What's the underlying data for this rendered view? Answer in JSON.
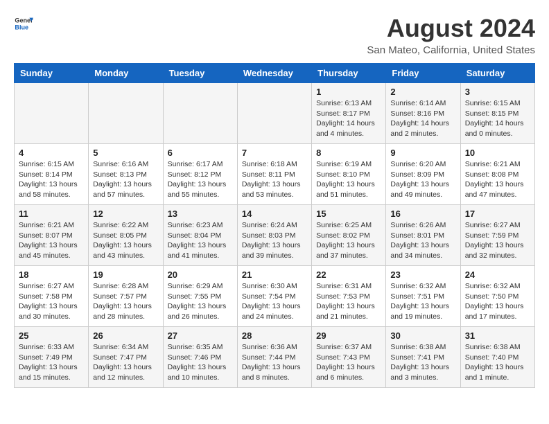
{
  "header": {
    "logo_general": "General",
    "logo_blue": "Blue",
    "month_year": "August 2024",
    "location": "San Mateo, California, United States"
  },
  "days_of_week": [
    "Sunday",
    "Monday",
    "Tuesday",
    "Wednesday",
    "Thursday",
    "Friday",
    "Saturday"
  ],
  "weeks": [
    [
      {
        "day": "",
        "content": ""
      },
      {
        "day": "",
        "content": ""
      },
      {
        "day": "",
        "content": ""
      },
      {
        "day": "",
        "content": ""
      },
      {
        "day": "1",
        "content": "Sunrise: 6:13 AM\nSunset: 8:17 PM\nDaylight: 14 hours\nand 4 minutes."
      },
      {
        "day": "2",
        "content": "Sunrise: 6:14 AM\nSunset: 8:16 PM\nDaylight: 14 hours\nand 2 minutes."
      },
      {
        "day": "3",
        "content": "Sunrise: 6:15 AM\nSunset: 8:15 PM\nDaylight: 14 hours\nand 0 minutes."
      }
    ],
    [
      {
        "day": "4",
        "content": "Sunrise: 6:15 AM\nSunset: 8:14 PM\nDaylight: 13 hours\nand 58 minutes."
      },
      {
        "day": "5",
        "content": "Sunrise: 6:16 AM\nSunset: 8:13 PM\nDaylight: 13 hours\nand 57 minutes."
      },
      {
        "day": "6",
        "content": "Sunrise: 6:17 AM\nSunset: 8:12 PM\nDaylight: 13 hours\nand 55 minutes."
      },
      {
        "day": "7",
        "content": "Sunrise: 6:18 AM\nSunset: 8:11 PM\nDaylight: 13 hours\nand 53 minutes."
      },
      {
        "day": "8",
        "content": "Sunrise: 6:19 AM\nSunset: 8:10 PM\nDaylight: 13 hours\nand 51 minutes."
      },
      {
        "day": "9",
        "content": "Sunrise: 6:20 AM\nSunset: 8:09 PM\nDaylight: 13 hours\nand 49 minutes."
      },
      {
        "day": "10",
        "content": "Sunrise: 6:21 AM\nSunset: 8:08 PM\nDaylight: 13 hours\nand 47 minutes."
      }
    ],
    [
      {
        "day": "11",
        "content": "Sunrise: 6:21 AM\nSunset: 8:07 PM\nDaylight: 13 hours\nand 45 minutes."
      },
      {
        "day": "12",
        "content": "Sunrise: 6:22 AM\nSunset: 8:05 PM\nDaylight: 13 hours\nand 43 minutes."
      },
      {
        "day": "13",
        "content": "Sunrise: 6:23 AM\nSunset: 8:04 PM\nDaylight: 13 hours\nand 41 minutes."
      },
      {
        "day": "14",
        "content": "Sunrise: 6:24 AM\nSunset: 8:03 PM\nDaylight: 13 hours\nand 39 minutes."
      },
      {
        "day": "15",
        "content": "Sunrise: 6:25 AM\nSunset: 8:02 PM\nDaylight: 13 hours\nand 37 minutes."
      },
      {
        "day": "16",
        "content": "Sunrise: 6:26 AM\nSunset: 8:01 PM\nDaylight: 13 hours\nand 34 minutes."
      },
      {
        "day": "17",
        "content": "Sunrise: 6:27 AM\nSunset: 7:59 PM\nDaylight: 13 hours\nand 32 minutes."
      }
    ],
    [
      {
        "day": "18",
        "content": "Sunrise: 6:27 AM\nSunset: 7:58 PM\nDaylight: 13 hours\nand 30 minutes."
      },
      {
        "day": "19",
        "content": "Sunrise: 6:28 AM\nSunset: 7:57 PM\nDaylight: 13 hours\nand 28 minutes."
      },
      {
        "day": "20",
        "content": "Sunrise: 6:29 AM\nSunset: 7:55 PM\nDaylight: 13 hours\nand 26 minutes."
      },
      {
        "day": "21",
        "content": "Sunrise: 6:30 AM\nSunset: 7:54 PM\nDaylight: 13 hours\nand 24 minutes."
      },
      {
        "day": "22",
        "content": "Sunrise: 6:31 AM\nSunset: 7:53 PM\nDaylight: 13 hours\nand 21 minutes."
      },
      {
        "day": "23",
        "content": "Sunrise: 6:32 AM\nSunset: 7:51 PM\nDaylight: 13 hours\nand 19 minutes."
      },
      {
        "day": "24",
        "content": "Sunrise: 6:32 AM\nSunset: 7:50 PM\nDaylight: 13 hours\nand 17 minutes."
      }
    ],
    [
      {
        "day": "25",
        "content": "Sunrise: 6:33 AM\nSunset: 7:49 PM\nDaylight: 13 hours\nand 15 minutes."
      },
      {
        "day": "26",
        "content": "Sunrise: 6:34 AM\nSunset: 7:47 PM\nDaylight: 13 hours\nand 12 minutes."
      },
      {
        "day": "27",
        "content": "Sunrise: 6:35 AM\nSunset: 7:46 PM\nDaylight: 13 hours\nand 10 minutes."
      },
      {
        "day": "28",
        "content": "Sunrise: 6:36 AM\nSunset: 7:44 PM\nDaylight: 13 hours\nand 8 minutes."
      },
      {
        "day": "29",
        "content": "Sunrise: 6:37 AM\nSunset: 7:43 PM\nDaylight: 13 hours\nand 6 minutes."
      },
      {
        "day": "30",
        "content": "Sunrise: 6:38 AM\nSunset: 7:41 PM\nDaylight: 13 hours\nand 3 minutes."
      },
      {
        "day": "31",
        "content": "Sunrise: 6:38 AM\nSunset: 7:40 PM\nDaylight: 13 hours\nand 1 minute."
      }
    ]
  ]
}
